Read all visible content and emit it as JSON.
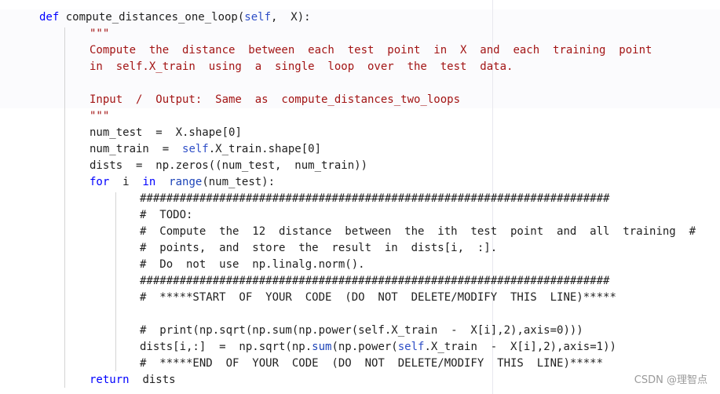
{
  "code": {
    "lines": [
      {
        "indent": 50,
        "parts": [
          {
            "t": "def ",
            "c": "kw"
          },
          {
            "t": "compute_distances_one_loop(",
            "c": "fn"
          },
          {
            "t": "self",
            "c": "sf"
          },
          {
            "t": ",  X):",
            "c": "fn"
          }
        ]
      },
      {
        "indent": 114,
        "parts": [
          {
            "t": "\"\"\"",
            "c": "str"
          }
        ]
      },
      {
        "indent": 114,
        "parts": [
          {
            "t": "Compute  the  distance  between  each  test  point  in  X  and  each  training  point",
            "c": "str"
          }
        ]
      },
      {
        "indent": 114,
        "parts": [
          {
            "t": "in  self.X_train  using  a  single  loop  over  the  test  data.",
            "c": "str"
          }
        ]
      },
      {
        "indent": 114,
        "parts": [
          {
            "t": "",
            "c": "str"
          }
        ]
      },
      {
        "indent": 114,
        "parts": [
          {
            "t": "Input  /  Output:  Same  as  compute_distances_two_loops",
            "c": "str"
          }
        ]
      },
      {
        "indent": 114,
        "parts": [
          {
            "t": "\"\"\"",
            "c": "str"
          }
        ]
      },
      {
        "indent": 114,
        "parts": [
          {
            "t": "num_test  =  X.shape[",
            "c": "fn"
          },
          {
            "t": "0",
            "c": "num"
          },
          {
            "t": "]",
            "c": "fn"
          }
        ]
      },
      {
        "indent": 114,
        "parts": [
          {
            "t": "num_train  =  ",
            "c": "fn"
          },
          {
            "t": "self",
            "c": "sf"
          },
          {
            "t": ".X_train.shape[",
            "c": "fn"
          },
          {
            "t": "0",
            "c": "num"
          },
          {
            "t": "]",
            "c": "fn"
          }
        ]
      },
      {
        "indent": 114,
        "parts": [
          {
            "t": "dists  =  np.zeros((num_test,  num_train))",
            "c": "fn"
          }
        ]
      },
      {
        "indent": 114,
        "parts": [
          {
            "t": "for ",
            "c": "kw"
          },
          {
            "t": " i  ",
            "c": "fn"
          },
          {
            "t": "in ",
            "c": "kw"
          },
          {
            "t": " ",
            "c": "fn"
          },
          {
            "t": "range",
            "c": "bi"
          },
          {
            "t": "(num_test):",
            "c": "fn"
          }
        ]
      },
      {
        "indent": 178,
        "parts": [
          {
            "t": "#######################################################################",
            "c": "cm"
          }
        ]
      },
      {
        "indent": 178,
        "parts": [
          {
            "t": "#  TODO:",
            "c": "cm"
          }
        ]
      },
      {
        "indent": 178,
        "parts": [
          {
            "t": "#  Compute  the  12  distance  between  the  ith  test  point  and  all  training  #",
            "c": "cm"
          }
        ]
      },
      {
        "indent": 178,
        "parts": [
          {
            "t": "#  points,  and  store  the  result  in  dists[i,  :].",
            "c": "cm"
          }
        ]
      },
      {
        "indent": 178,
        "parts": [
          {
            "t": "#  Do  not  use  np.linalg.norm().",
            "c": "cm"
          }
        ]
      },
      {
        "indent": 178,
        "parts": [
          {
            "t": "#######################################################################",
            "c": "cm"
          }
        ]
      },
      {
        "indent": 178,
        "parts": [
          {
            "t": "#  *****START  OF  YOUR  CODE  (DO  NOT  DELETE/MODIFY  THIS  LINE)*****",
            "c": "cm"
          }
        ]
      },
      {
        "indent": 178,
        "parts": [
          {
            "t": "",
            "c": "cm"
          }
        ]
      },
      {
        "indent": 178,
        "parts": [
          {
            "t": "#  print(np.sqrt(np.sum(np.power(self.X_train  -  X[i],2),axis=0)))",
            "c": "cm"
          }
        ]
      },
      {
        "indent": 178,
        "parts": [
          {
            "t": "dists[i,:]  =  np.sqrt(np.",
            "c": "fn"
          },
          {
            "t": "sum",
            "c": "bi"
          },
          {
            "t": "(np.power(",
            "c": "fn"
          },
          {
            "t": "self",
            "c": "sf"
          },
          {
            "t": ".X_train  -  X[i],",
            "c": "fn"
          },
          {
            "t": "2",
            "c": "num"
          },
          {
            "t": "),axis=",
            "c": "fn"
          },
          {
            "t": "1",
            "c": "num"
          },
          {
            "t": "))",
            "c": "fn"
          }
        ]
      },
      {
        "indent": 178,
        "parts": [
          {
            "t": "#  *****END  OF  YOUR  CODE  (DO  NOT  DELETE/MODIFY  THIS  LINE)*****",
            "c": "cm"
          }
        ]
      },
      {
        "indent": 114,
        "parts": [
          {
            "t": "return ",
            "c": "kw"
          },
          {
            "t": " dists",
            "c": "fn"
          }
        ]
      }
    ]
  },
  "watermark": "CSDN @理智点"
}
